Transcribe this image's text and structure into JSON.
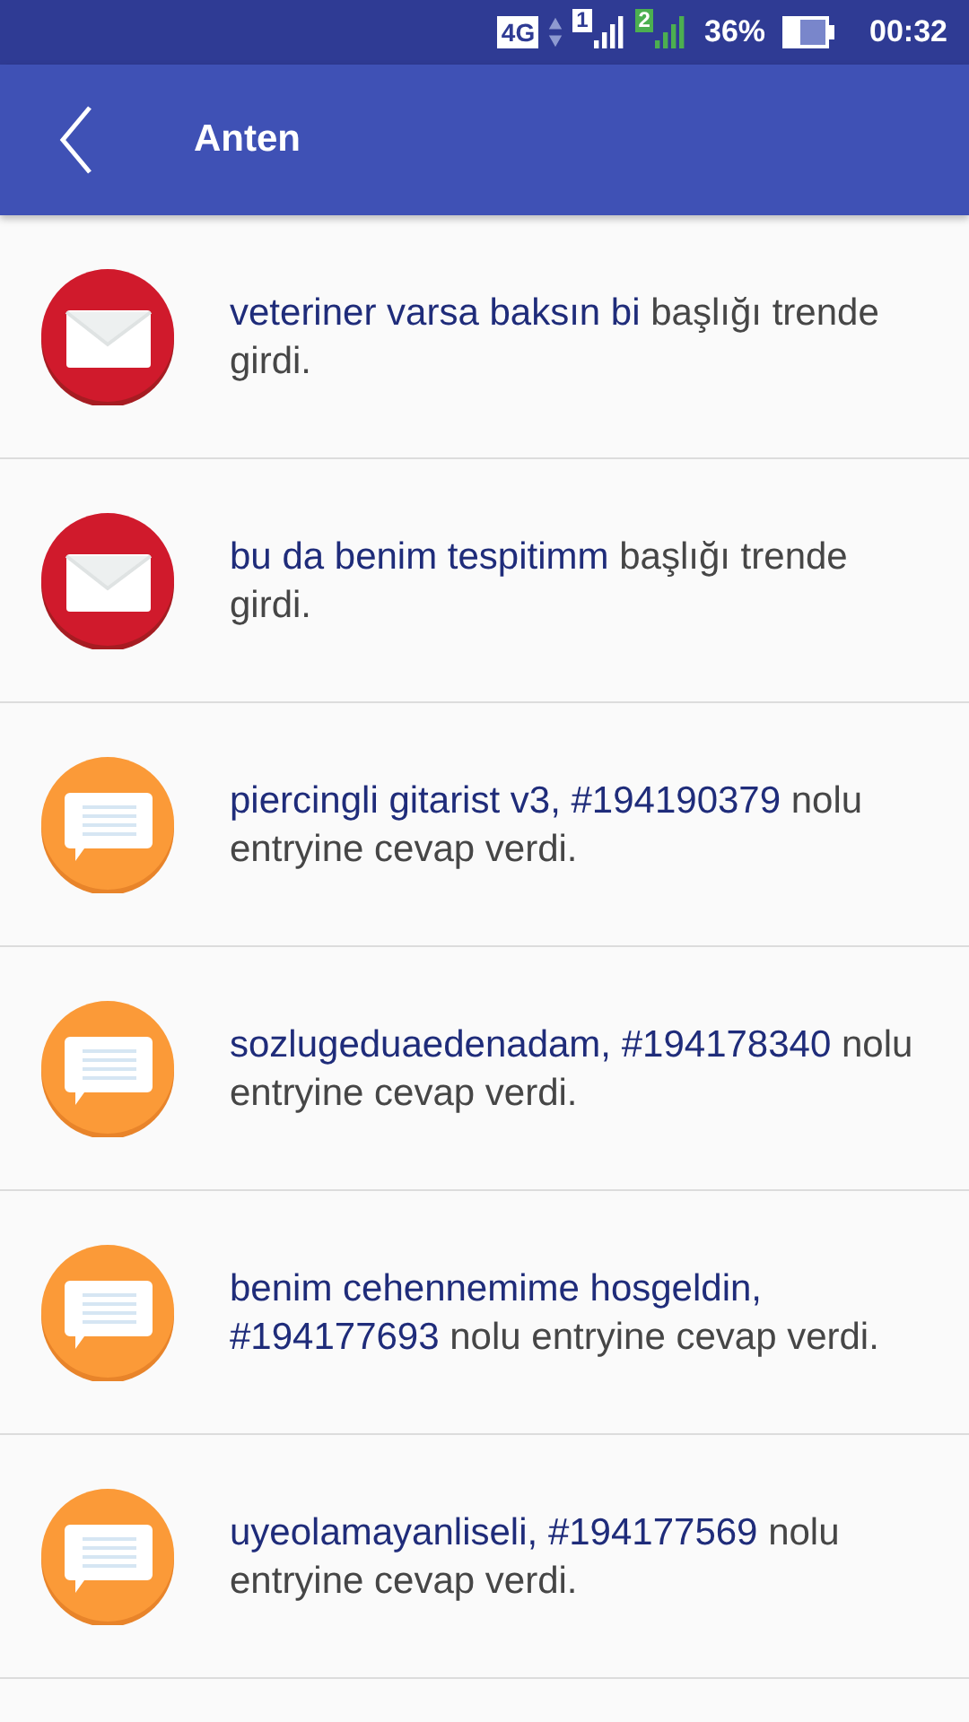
{
  "status_bar": {
    "network": "4G",
    "sim_1": "1",
    "sim_2": "2",
    "battery": "36%",
    "time": "00:32"
  },
  "app_bar": {
    "title": "Anten"
  },
  "notifications": [
    {
      "kind": "mail",
      "title": "veteriner varsa baksın bi",
      "text": "başlığı trende girdi."
    },
    {
      "kind": "mail",
      "title": "bu da benim tespitimm",
      "text": "başlığı trende girdi."
    },
    {
      "kind": "reply",
      "title": "piercingli gitarist v3,",
      "entry": "#194190379",
      "text": "nolu entryine cevap verdi."
    },
    {
      "kind": "reply",
      "title": "sozlugeduaedenadam,",
      "entry": "#194178340",
      "text": "nolu entryine cevap verdi."
    },
    {
      "kind": "reply",
      "title": "benim cehennemime hosgeldin,",
      "entry": "#194177693",
      "text": "nolu entryine cevap verdi."
    },
    {
      "kind": "reply",
      "title": "uyeolamayanliseli,",
      "entry": "#194177569",
      "text": "nolu entryine cevap verdi."
    }
  ]
}
